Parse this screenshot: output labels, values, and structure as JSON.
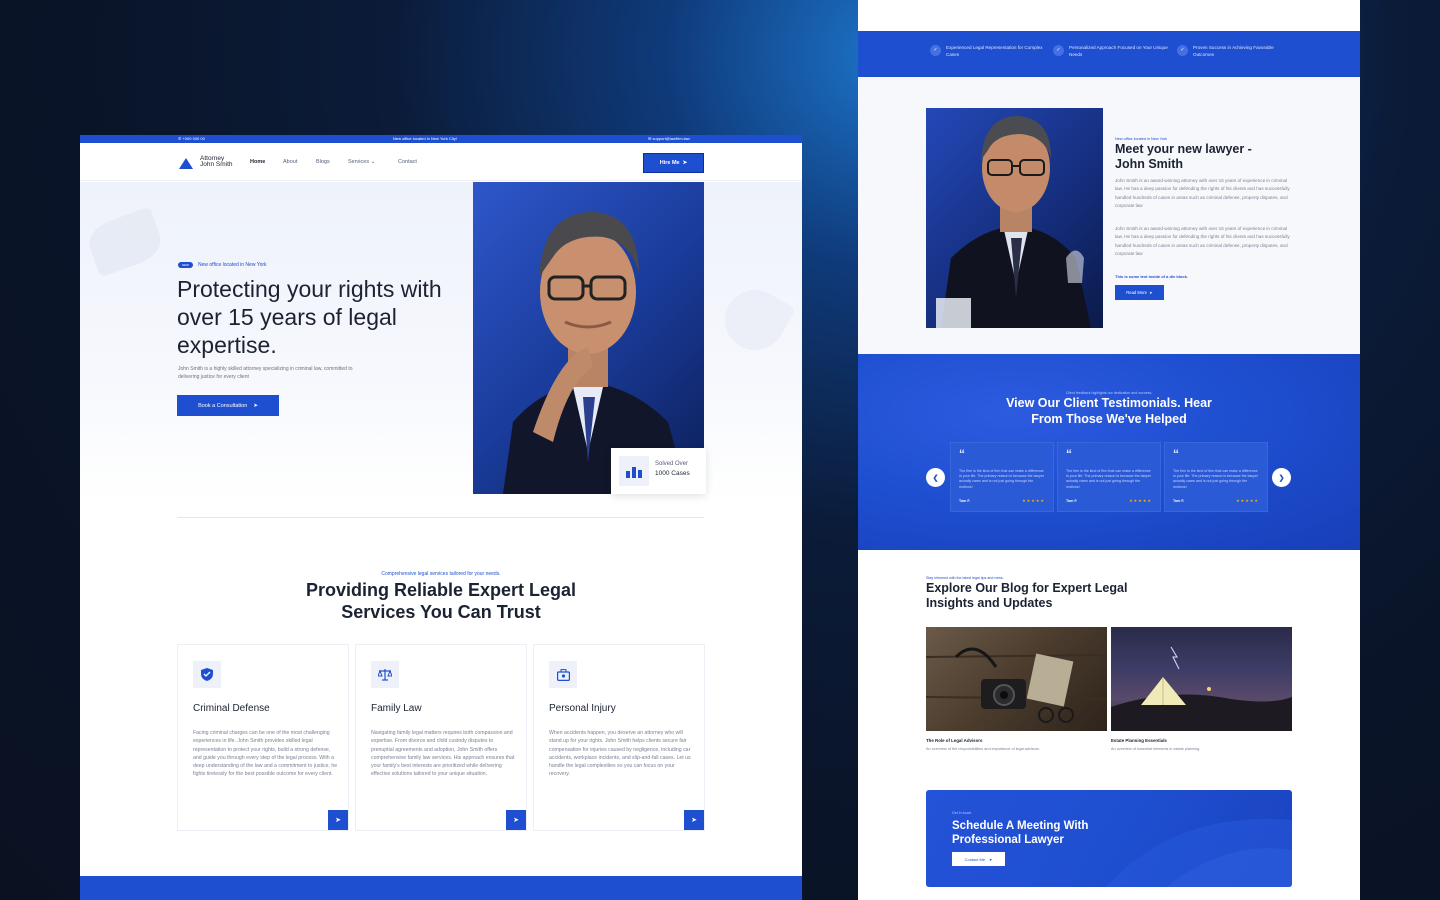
{
  "left": {
    "topbar": {
      "phone": "+000 000 00",
      "center": "New office located in New York City!",
      "email": "support@lawfirm.law"
    },
    "nav": {
      "brand_line1": "Attorney",
      "brand_line2": "John Smith",
      "links": [
        "Home",
        "About",
        "Blogs",
        "Services",
        "Contact"
      ],
      "hire_label": "Hire Me"
    },
    "hero": {
      "badge": "NEW",
      "badge_text": "New office located in New York",
      "title": "Protecting your rights with over 15 years of legal expertise.",
      "desc": "John Smith is a highly skilled attorney specializing in criminal law, committed to delivering justice for every client",
      "cta": "Book a Consultation",
      "solved_label": "Solved Over",
      "solved_count": "1000 Cases"
    },
    "services": {
      "eyebrow": "Comprehensive legal services tailored for your needs.",
      "title": "Providing Reliable Expert Legal Services You Can Trust",
      "cards": [
        {
          "icon": "shield-icon",
          "title": "Criminal Defense",
          "text": "Facing criminal charges can be one of the most challenging experiences in life. John Smith provides skilled legal representation to protect your rights, build a strong defense, and guide you through every step of the legal process. With a deep understanding of the law and a commitment to justice, he fights tirelessly for the best possible outcome for every client."
        },
        {
          "icon": "scales-icon",
          "title": "Family Law",
          "text": "Navigating family legal matters requires both compassion and expertise. From divorce and child custody disputes to prenuptial agreements and adoption, John Smith offers comprehensive family law services. His approach ensures that your family's best interests are prioritized while delivering effective solutions tailored to your unique situation."
        },
        {
          "icon": "briefcase-icon",
          "title": "Personal Injury",
          "text": "When accidents happen, you deserve an attorney who will stand up for your rights. John Smith helps clients secure fair compensation for injuries caused by negligence, including car accidents, workplace incidents, and slip-and-fall cases. Let us handle the legal complexities so you can focus on your recovery."
        }
      ]
    }
  },
  "right": {
    "features": [
      "Experienced Legal Representation for Complex Cases",
      "Personalized Approach Focused on Your Unique Needs",
      "Proven Success in Achieving Favorable Outcomes"
    ],
    "about": {
      "eyebrow": "New office located in New York",
      "title": "Meet your new lawyer - John Smith",
      "p1": "John Smith is an award-winning attorney with over 15 years of experience in criminal law. He has a deep passion for defending the rights of his clients and has successfully handled hundreds of cases in areas such as criminal defense, property disputes, and corporate law",
      "p2": "John Smith is an award-winning attorney with over 15 years of experience in criminal law. He has a deep passion for defending the rights of his clients and has successfully handled hundreds of cases in areas such as criminal defense, property disputes, and corporate law",
      "note": "This is some text inside of a div block.",
      "cta": "Read More"
    },
    "testimonials": {
      "eyebrow": "Client feedback highlights our dedication and success.",
      "title": "View Our Client Testimonials. Hear From Those We've Helped",
      "items": [
        {
          "text": "The firm is the kind of firm that can make a difference in your life. The primary reason is because the lawyer actually cares and is not just going through the motions!",
          "name": "Tom F.",
          "stars": "★★★★★"
        },
        {
          "text": "The firm is the kind of firm that can make a difference in your life. The primary reason is because the lawyer actually cares and is not just going through the motions!",
          "name": "Tom F.",
          "stars": "★★★★★"
        },
        {
          "text": "The firm is the kind of firm that can make a difference in your life. The primary reason is because the lawyer actually cares and is not just going through the motions!",
          "name": "Tom F.",
          "stars": "★★★★★"
        }
      ]
    },
    "blog": {
      "eyebrow": "Stay informed with the latest legal tips and news.",
      "title": "Explore Our Blog for Expert Legal Insights and Updates",
      "posts": [
        {
          "title": "The Role of Legal Advisors",
          "sub": "An overview of the responsibilities and importance of legal advisors."
        },
        {
          "title": "Estate Planning Essentials",
          "sub": "An overview of essential elements in estate planning."
        }
      ]
    },
    "cta": {
      "eyebrow": "Get in touch",
      "title": "Schedule A Meeting With Professional Lawyer",
      "button": "Contact Me"
    }
  },
  "colors": {
    "accent": "#1f4fd1",
    "background": "#0a1428",
    "star": "#f5b700"
  }
}
